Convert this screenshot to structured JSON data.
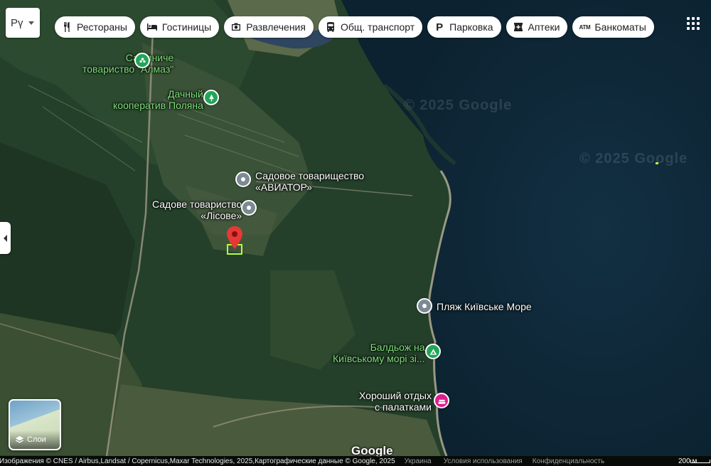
{
  "language_selector": {
    "label": "Рү"
  },
  "chips": [
    {
      "icon": "cutlery-icon",
      "label": "Рестораны"
    },
    {
      "icon": "bed-icon",
      "label": "Гостиницы"
    },
    {
      "icon": "camera-icon",
      "label": "Развлечения"
    },
    {
      "icon": "bus-icon",
      "label": "Общ. транспорт"
    },
    {
      "icon": "parking-icon",
      "glyph": "P",
      "label": "Парковка"
    },
    {
      "icon": "pharmacy-icon",
      "label": "Аптеки"
    },
    {
      "icon": "atm-icon",
      "glyph": "ATM",
      "label": "Банкоматы"
    }
  ],
  "places": {
    "almaz": {
      "line1": "Садівниче",
      "line2": "товариство \"Алмаз\"",
      "pin": "park-icon"
    },
    "polyana": {
      "line1": "Дачный",
      "line2": "кооператив Поляна",
      "pin": "park-icon"
    },
    "aviator": {
      "line1": "Садовое товарищество",
      "line2": "«АВИАТОР»",
      "pin": "place-icon"
    },
    "lisove": {
      "line1": "Садове товариство",
      "line2": "«Лісове»",
      "pin": "place-icon"
    },
    "beach": {
      "line1": "Пляж Київське Море",
      "pin": "place-icon"
    },
    "baldoj": {
      "line1": "Балдьож на",
      "line2": "Київському морі зі...",
      "pin": "campsite-icon"
    },
    "camping": {
      "line1": "Хороший отдых",
      "line2": "с палатками",
      "pin": "campground-icon"
    }
  },
  "watermarks": [
    "© 2025 Google",
    "© 2025 Google"
  ],
  "layers": {
    "label": "Слои"
  },
  "google_logo": "Google",
  "attribution": {
    "imagery": "Изображения © CNES / Airbus,Landsat / Copernicus,Maxar Technologies, 2025,Картографические данные © Google, 2025",
    "country": "Украина",
    "terms": "Условия использования",
    "privacy": "Конфиденциальность",
    "scale": "200 м"
  },
  "colors": {
    "water": "#102a3a",
    "forest": "#26412a",
    "park_label": "#7ee07a",
    "marker": "#e53935",
    "selection": "#b4ff3a"
  }
}
